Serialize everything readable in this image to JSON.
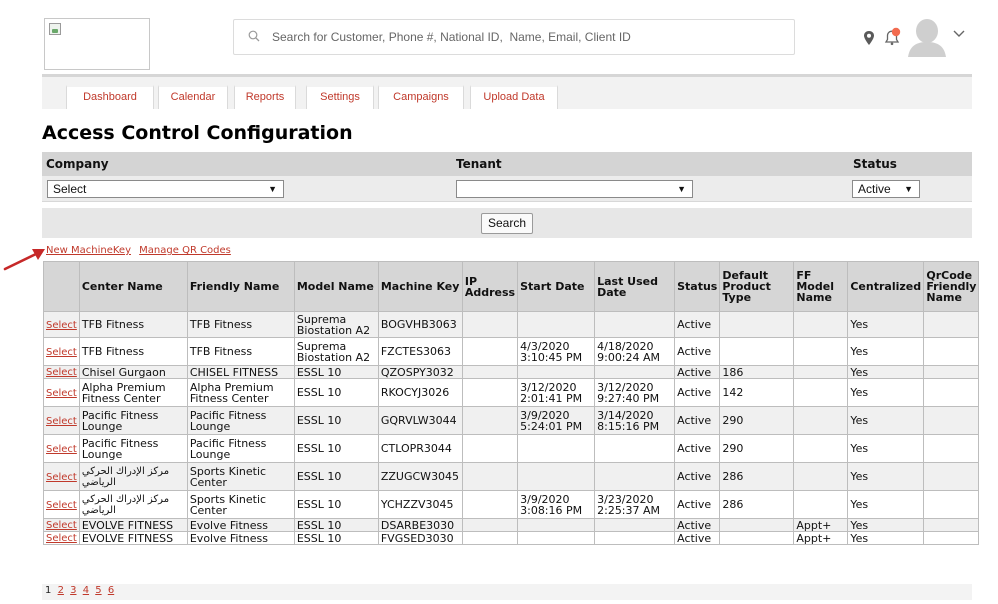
{
  "header": {
    "search_placeholder": "Search for Customer, Phone #, National ID,  Name, Email, Client ID",
    "icons": [
      "location-icon",
      "bell-icon",
      "avatar-icon",
      "chevron-down-icon"
    ],
    "notification_badge_color": "#f26b4f"
  },
  "tabs": [
    "Dashboard",
    "Calendar",
    "Reports",
    "Settings",
    "Campaigns",
    "Upload Data"
  ],
  "page_title": "Access Control Configuration",
  "filters": {
    "company_label": "Company",
    "tenant_label": "Tenant",
    "status_label": "Status",
    "company_value": "Select",
    "tenant_value": "",
    "status_value": "Active",
    "search_button": "Search"
  },
  "links": {
    "new_machine_key": "New MachineKey",
    "manage_qr": "Manage QR Codes"
  },
  "table": {
    "columns": [
      "",
      "Center Name",
      "Friendly Name",
      "Model Name",
      "Machine Key",
      "IP Address",
      "Start Date",
      "Last Used Date",
      "Status",
      "Default Product Type",
      "FF Model Name",
      "Centralized",
      "QrCode Friendly Name"
    ],
    "select_label": "Select",
    "rows": [
      {
        "center": "TFB Fitness",
        "friendly": "TFB Fitness",
        "model": "Suprema Biostation A2",
        "key": "BOGVHB3063",
        "ip": "",
        "start": "",
        "last": "",
        "status": "Active",
        "dpt": "",
        "ff": "",
        "central": "Yes",
        "qr": ""
      },
      {
        "center": "TFB Fitness",
        "friendly": "TFB Fitness",
        "model": "Suprema Biostation A2",
        "key": "FZCTES3063",
        "ip": "",
        "start": "4/3/2020 3:10:45 PM",
        "last": "4/18/2020 9:00:24 AM",
        "status": "Active",
        "dpt": "",
        "ff": "",
        "central": "Yes",
        "qr": ""
      },
      {
        "center": "Chisel Gurgaon",
        "friendly": "CHISEL FITNESS",
        "model": "ESSL 10",
        "key": "QZOSPY3032",
        "ip": "",
        "start": "",
        "last": "",
        "status": "Active",
        "dpt": "186",
        "ff": "",
        "central": "Yes",
        "qr": ""
      },
      {
        "center": "Alpha Premium Fitness Center",
        "friendly": "Alpha Premium Fitness Center",
        "model": "ESSL 10",
        "key": "RKOCYJ3026",
        "ip": "",
        "start": "3/12/2020 2:01:41 PM",
        "last": "3/12/2020 9:27:40 PM",
        "status": "Active",
        "dpt": "142",
        "ff": "",
        "central": "Yes",
        "qr": ""
      },
      {
        "center": "Pacific Fitness Lounge",
        "friendly": "Pacific Fitness Lounge",
        "model": "ESSL 10",
        "key": "GQRVLW3044",
        "ip": "",
        "start": "3/9/2020 5:24:01 PM",
        "last": "3/14/2020 8:15:16 PM",
        "status": "Active",
        "dpt": "290",
        "ff": "",
        "central": "Yes",
        "qr": ""
      },
      {
        "center": "Pacific Fitness Lounge",
        "friendly": "Pacific Fitness Lounge",
        "model": "ESSL 10",
        "key": "CTLOPR3044",
        "ip": "",
        "start": "",
        "last": "",
        "status": "Active",
        "dpt": "290",
        "ff": "",
        "central": "Yes",
        "qr": ""
      },
      {
        "center": "مركز الإدراك الحركي الرياضي",
        "friendly": "Sports Kinetic Center",
        "model": "ESSL 10",
        "key": "ZZUGCW3045",
        "ip": "",
        "start": "",
        "last": "",
        "status": "Active",
        "dpt": "286",
        "ff": "",
        "central": "Yes",
        "qr": "",
        "rtl": true
      },
      {
        "center": "مركز الإدراك الحركي الرياضي",
        "friendly": "Sports Kinetic Center",
        "model": "ESSL 10",
        "key": "YCHZZV3045",
        "ip": "",
        "start": "3/9/2020 3:08:16 PM",
        "last": "3/23/2020 2:25:37 AM",
        "status": "Active",
        "dpt": "286",
        "ff": "",
        "central": "Yes",
        "qr": "",
        "rtl": true
      },
      {
        "center": "EVOLVE FITNESS",
        "friendly": "Evolve Fitness",
        "model": "ESSL 10",
        "key": "DSARBE3030",
        "ip": "",
        "start": "",
        "last": "",
        "status": "Active",
        "dpt": "",
        "ff": "Appt+",
        "central": "Yes",
        "qr": ""
      },
      {
        "center": "EVOLVE FITNESS",
        "friendly": "Evolve Fitness",
        "model": "ESSL 10",
        "key": "FVGSED3030",
        "ip": "",
        "start": "",
        "last": "",
        "status": "Active",
        "dpt": "",
        "ff": "Appt+",
        "central": "Yes",
        "qr": ""
      }
    ]
  },
  "pager": {
    "current": "1",
    "pages": [
      "2",
      "3",
      "4",
      "5",
      "6"
    ]
  },
  "colors": {
    "accent": "#c0392b",
    "header_gray": "#d6d6d6"
  }
}
